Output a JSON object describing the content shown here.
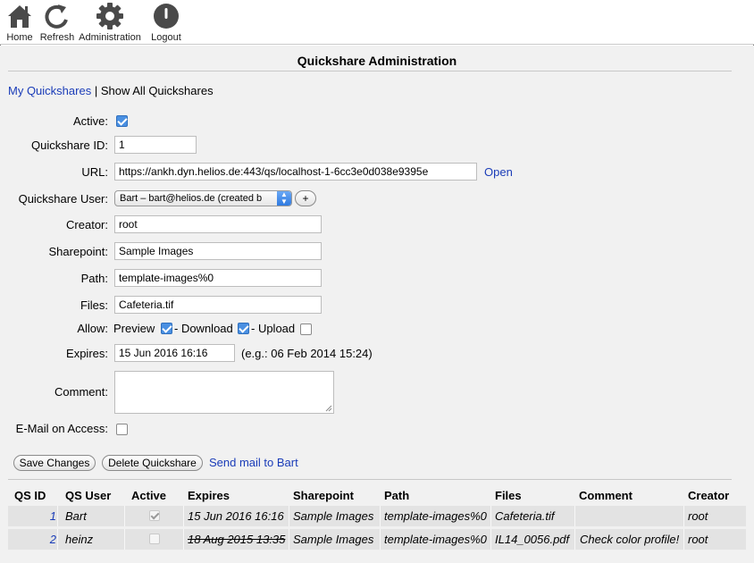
{
  "toolbar": {
    "home": {
      "label": "Home",
      "icon": "home-icon"
    },
    "refresh": {
      "label": "Refresh",
      "icon": "refresh-icon"
    },
    "administration": {
      "label": "Administration",
      "icon": "gear-icon"
    },
    "logout": {
      "label": "Logout",
      "icon": "power-icon"
    }
  },
  "page": {
    "title": "Quickshare Administration"
  },
  "nav": {
    "my_quickshares": "My Quickshares",
    "separator": "|",
    "show_all": "Show All Quickshares"
  },
  "form": {
    "active": {
      "label": "Active:",
      "checked": true
    },
    "qs_id": {
      "label": "Quickshare ID:",
      "value": "1"
    },
    "url": {
      "label": "URL:",
      "value": "https://ankh.dyn.helios.de:443/qs/localhost-1-6cc3e0d038e9395e",
      "open_link": "Open"
    },
    "user": {
      "label": "Quickshare User:",
      "value": "Bart – bart@helios.de (created b",
      "add_label": "+"
    },
    "creator": {
      "label": "Creator:",
      "value": "root"
    },
    "sharepoint": {
      "label": "Sharepoint:",
      "value": "Sample Images"
    },
    "path": {
      "label": "Path:",
      "value": "template-images%0"
    },
    "files": {
      "label": "Files:",
      "value": "Cafeteria.tif"
    },
    "allow": {
      "label": "Allow:",
      "preview": {
        "label": "Preview",
        "checked": true
      },
      "download": {
        "label": "- Download",
        "checked": true
      },
      "upload": {
        "label": "- Upload",
        "checked": false
      }
    },
    "expires": {
      "label": "Expires:",
      "value": "15 Jun 2016 16:16",
      "hint": "(e.g.: 06 Feb 2014 15:24)"
    },
    "comment": {
      "label": "Comment:",
      "value": ""
    },
    "email_on_access": {
      "label": "E-Mail on Access:",
      "checked": false
    }
  },
  "actions": {
    "save": "Save Changes",
    "delete": "Delete Quickshare",
    "send_mail": "Send mail to Bart"
  },
  "table": {
    "headers": [
      "QS ID",
      "QS User",
      "Active",
      "Expires",
      "Sharepoint",
      "Path",
      "Files",
      "Comment",
      "Creator"
    ],
    "rows": [
      {
        "id": "1",
        "user": "Bart",
        "active": true,
        "expires": "15 Jun 2016 16:16",
        "expired": false,
        "sharepoint": "Sample Images",
        "path": "template-images%0",
        "files": "Cafeteria.tif",
        "comment": "",
        "creator": "root"
      },
      {
        "id": "2",
        "user": "heinz",
        "active": false,
        "expires": "18 Aug 2015 13:35",
        "expired": true,
        "sharepoint": "Sample Images",
        "path": "template-images%0",
        "files": "IL14_0056.pdf",
        "comment": "Check color profile!",
        "creator": "root"
      }
    ]
  },
  "colors": {
    "link": "#1a3cb8",
    "checkbox": "#4a90e2",
    "background": "#f1f1f1",
    "row": "#e3e3e3"
  }
}
